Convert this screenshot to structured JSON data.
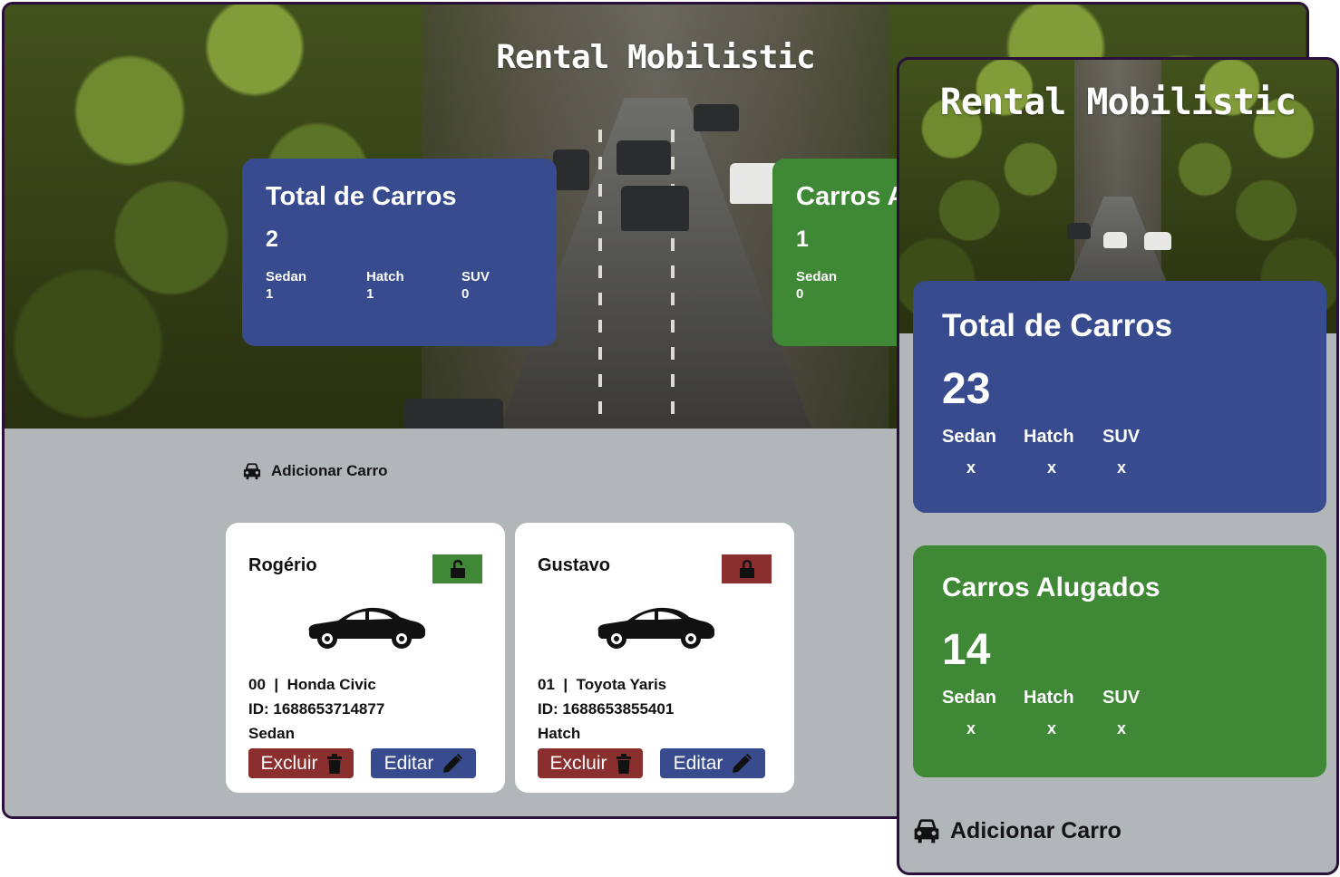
{
  "desktop": {
    "brand": "Rental Mobilistic",
    "total_card": {
      "title": "Total de Carros",
      "count": "2",
      "types": [
        {
          "label": "Sedan",
          "value": "1"
        },
        {
          "label": "Hatch",
          "value": "1"
        },
        {
          "label": "SUV",
          "value": "0"
        }
      ]
    },
    "rented_card": {
      "title": "Carros Alugados",
      "count": "1",
      "types": [
        {
          "label": "Sedan",
          "value": "0"
        }
      ]
    },
    "add_label": "Adicionar Carro",
    "cars": [
      {
        "owner": "Rogério",
        "lock_state": "unlocked",
        "number": "00",
        "separator": "|",
        "model": "Honda Civic",
        "id": "ID: 1688653714877",
        "type": "Sedan",
        "delete_label": "Excluir",
        "edit_label": "Editar"
      },
      {
        "owner": "Gustavo",
        "lock_state": "locked",
        "number": "01",
        "separator": "|",
        "model": "Toyota Yaris",
        "id": "ID: 1688653855401",
        "type": "Hatch",
        "delete_label": "Excluir",
        "edit_label": "Editar"
      }
    ]
  },
  "mobile": {
    "brand": "Rental Mobilistic",
    "total_card": {
      "title": "Total de Carros",
      "count": "23",
      "types": [
        {
          "label": "Sedan",
          "value": "x"
        },
        {
          "label": "Hatch",
          "value": "x"
        },
        {
          "label": "SUV",
          "value": "x"
        }
      ]
    },
    "rented_card": {
      "title": "Carros Alugados",
      "count": "14",
      "types": [
        {
          "label": "Sedan",
          "value": "x"
        },
        {
          "label": "Hatch",
          "value": "x"
        },
        {
          "label": "SUV",
          "value": "x"
        }
      ]
    },
    "add_label": "Adicionar Carro"
  },
  "colors": {
    "blue_card": "#374b8e",
    "green_card": "#3f8835",
    "red_button": "#8a2e2e",
    "page_bg": "#b1b7b9",
    "frame_border": "#2a0f3a"
  },
  "icons": {
    "add": "car-front-icon",
    "delete": "trash-icon",
    "edit": "pencil-icon",
    "lock_open": "unlock-icon",
    "lock_closed": "lock-icon",
    "car": "sedan-car-icon"
  }
}
